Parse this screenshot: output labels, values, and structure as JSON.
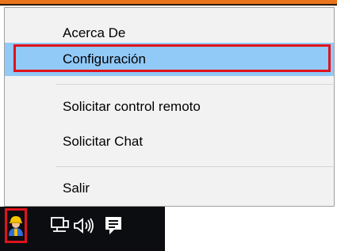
{
  "menu": {
    "items": [
      {
        "label": "Acerca De"
      },
      {
        "label": "Configuración"
      },
      {
        "label": "Solicitar control remoto"
      },
      {
        "label": "Solicitar Chat"
      },
      {
        "label": "Salir"
      }
    ]
  },
  "taskbar": {
    "icons": [
      "worker-app-icon",
      "network-icon",
      "volume-icon",
      "notification-icon"
    ]
  },
  "colors": {
    "highlight_bg": "#91c9f7",
    "annotation_red": "#e0121c",
    "menu_bg": "#f2f2f2",
    "taskbar_bg": "#0b0d10"
  }
}
